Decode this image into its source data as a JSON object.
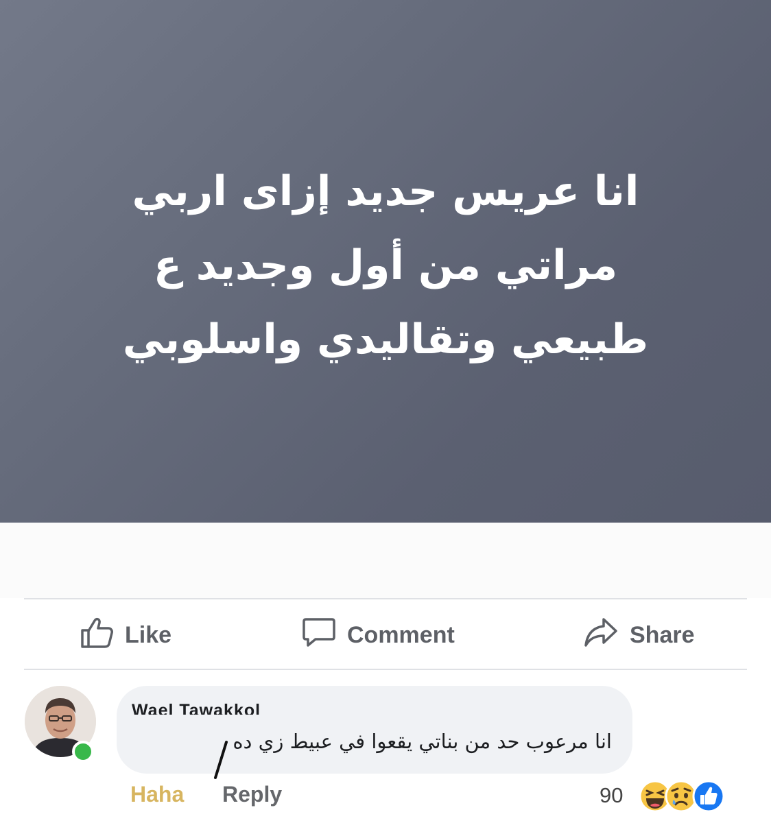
{
  "post": {
    "lines": [
      "انا عريس جديد إزاى اربي",
      "مراتي من أول وجديد ع",
      "طبيعي وتقاليدي واسلوبي"
    ]
  },
  "actions": {
    "like": "Like",
    "comment": "Comment",
    "share": "Share"
  },
  "comment": {
    "author": "Wael Tawakkol",
    "text": "انا مرعوب حد من بناتي يقعوا في عبيط زي ده",
    "reaction_label": "Haha",
    "reply_label": "Reply",
    "reaction_count": "90",
    "reactions": [
      "haha-icon",
      "sad-icon",
      "like-icon"
    ]
  },
  "colors": {
    "post_background": "#666c7c",
    "haha_link": "#d7b560",
    "online": "#38b84a",
    "like_blue": "#1877f2",
    "reaction_yellow": "#f7c544"
  }
}
